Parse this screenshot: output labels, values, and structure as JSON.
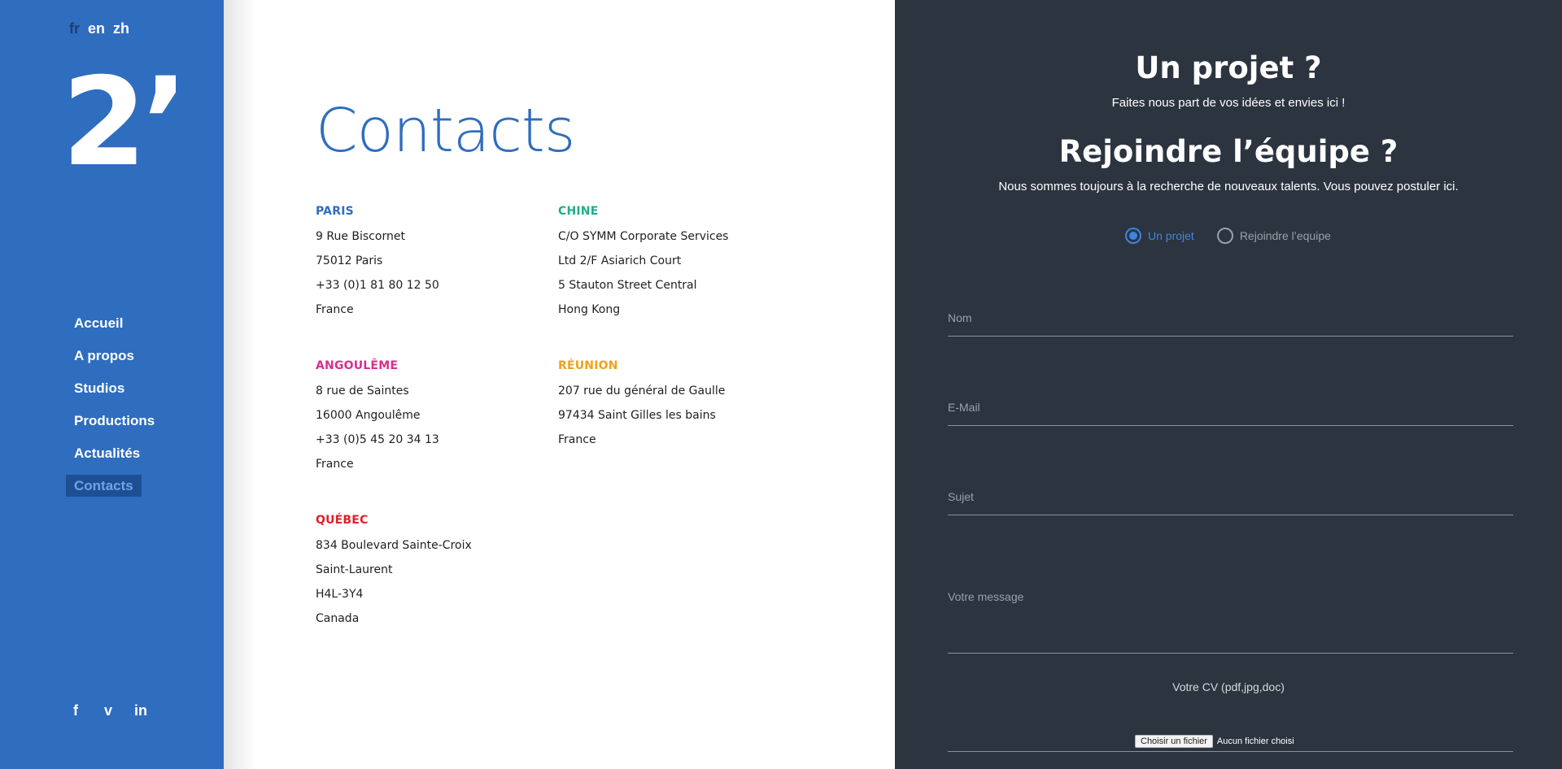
{
  "colors": {
    "sidebar": "#2f6dbf",
    "right_panel": "#2c3440",
    "accent_blue": "#2f6dbf",
    "paris": "#2f6dbf",
    "chine": "#1fae8a",
    "angouleme": "#d62f8e",
    "reunion": "#f0a21a",
    "quebec": "#e0202a"
  },
  "sidebar": {
    "languages": [
      "fr",
      "en",
      "zh"
    ],
    "logo_text": "2’",
    "nav": [
      "Accueil",
      "A propos",
      "Studios",
      "Productions",
      "Actualités",
      "Contacts"
    ],
    "social": [
      "facebook-icon",
      "vimeo-icon",
      "linkedin-icon"
    ],
    "social_glyphs": [
      "f",
      "v",
      "in"
    ]
  },
  "main": {
    "title": "Contacts",
    "offices": [
      {
        "name": "PARIS",
        "color": "#2f6dbf",
        "lines": [
          "9 Rue Biscornet",
          "75012 Paris",
          "+33 (0)1 81 80 12 50",
          "France"
        ]
      },
      {
        "name": "CHINE",
        "color": "#1fae8a",
        "lines": [
          "C/O SYMM Corporate Services",
          "Ltd 2/F Asiarich Court",
          "5 Stauton Street Central",
          "Hong Kong"
        ]
      },
      {
        "name": "ANGOULÊME",
        "color": "#d62f8e",
        "lines": [
          "8 rue de Saintes",
          "16000 Angoulême",
          "+33 (0)5 45 20 34 13",
          "France"
        ]
      },
      {
        "name": "RÉUNION",
        "color": "#f0a21a",
        "lines": [
          "207 rue du général de Gaulle",
          "97434 Saint Gilles les bains",
          "France"
        ]
      },
      {
        "name": "QUÉBEC",
        "color": "#e0202a",
        "lines": [
          "834 Boulevard Sainte-Croix",
          "Saint-Laurent",
          "H4L-3Y4",
          "Canada"
        ]
      }
    ]
  },
  "form": {
    "title1": "Un projet ?",
    "subtitle1": "Faites nous part de vos idées et envies ici !",
    "title2": "Rejoindre l’équipe ?",
    "subtitle2": "Nous sommes toujours à la recherche de nouveaux talents. Vous pouvez postuler ici.",
    "radio_project": "Un projet",
    "radio_team": "Rejoindre l’equipe",
    "selected": "Un projet",
    "name_label": "Nom",
    "email_label": "E-Mail",
    "subject_label": "Sujet",
    "message_label": "Votre message",
    "cv_label": "Votre CV (pdf,jpg,doc)",
    "file_button": "Choisir un fichier",
    "file_status": "Aucun fichier choisi"
  }
}
